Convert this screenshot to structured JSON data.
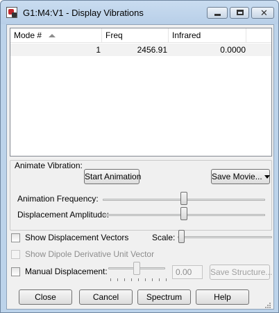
{
  "window": {
    "title": "G1:M4:V1 - Display Vibrations"
  },
  "title_buttons": {
    "minimize_icon": "minimize-icon",
    "maximize_icon": "maximize-icon",
    "close_icon": "close-icon"
  },
  "list": {
    "columns": [
      "Mode #",
      "Freq",
      "Infrared"
    ],
    "sort_icon": "sort-ascending-icon",
    "rows": [
      [
        "1",
        "2456.91",
        "0.0000"
      ]
    ]
  },
  "animate": {
    "group_label": "Animate Vibration:",
    "start_button": "Start Animation",
    "save_movie_button": "Save Movie...",
    "frequency_label": "Animation Frequency:",
    "amplitude_label": "Displacement Amplitude:",
    "frequency_level": 0.5,
    "amplitude_level": 0.5
  },
  "options": {
    "show_vectors_label": "Show Displacement Vectors",
    "show_vectors_checked": false,
    "scale_label": "Scale:",
    "scale_level": 0.0,
    "dipole_label": "Show Dipole Derivative Unit Vector",
    "dipole_checked": false,
    "manual_label": "Manual Displacement:",
    "manual_checked": false,
    "manual_level": 0.5,
    "manual_value": "0.00",
    "save_structure_button": "Save Structure..."
  },
  "footer": {
    "close": "Close",
    "cancel": "Cancel",
    "spectrum": "Spectrum",
    "help": "Help"
  },
  "colors": {
    "frame": "#bcd3ea",
    "client": "#f0f0f0",
    "selected_row": "#f2f2f2"
  }
}
